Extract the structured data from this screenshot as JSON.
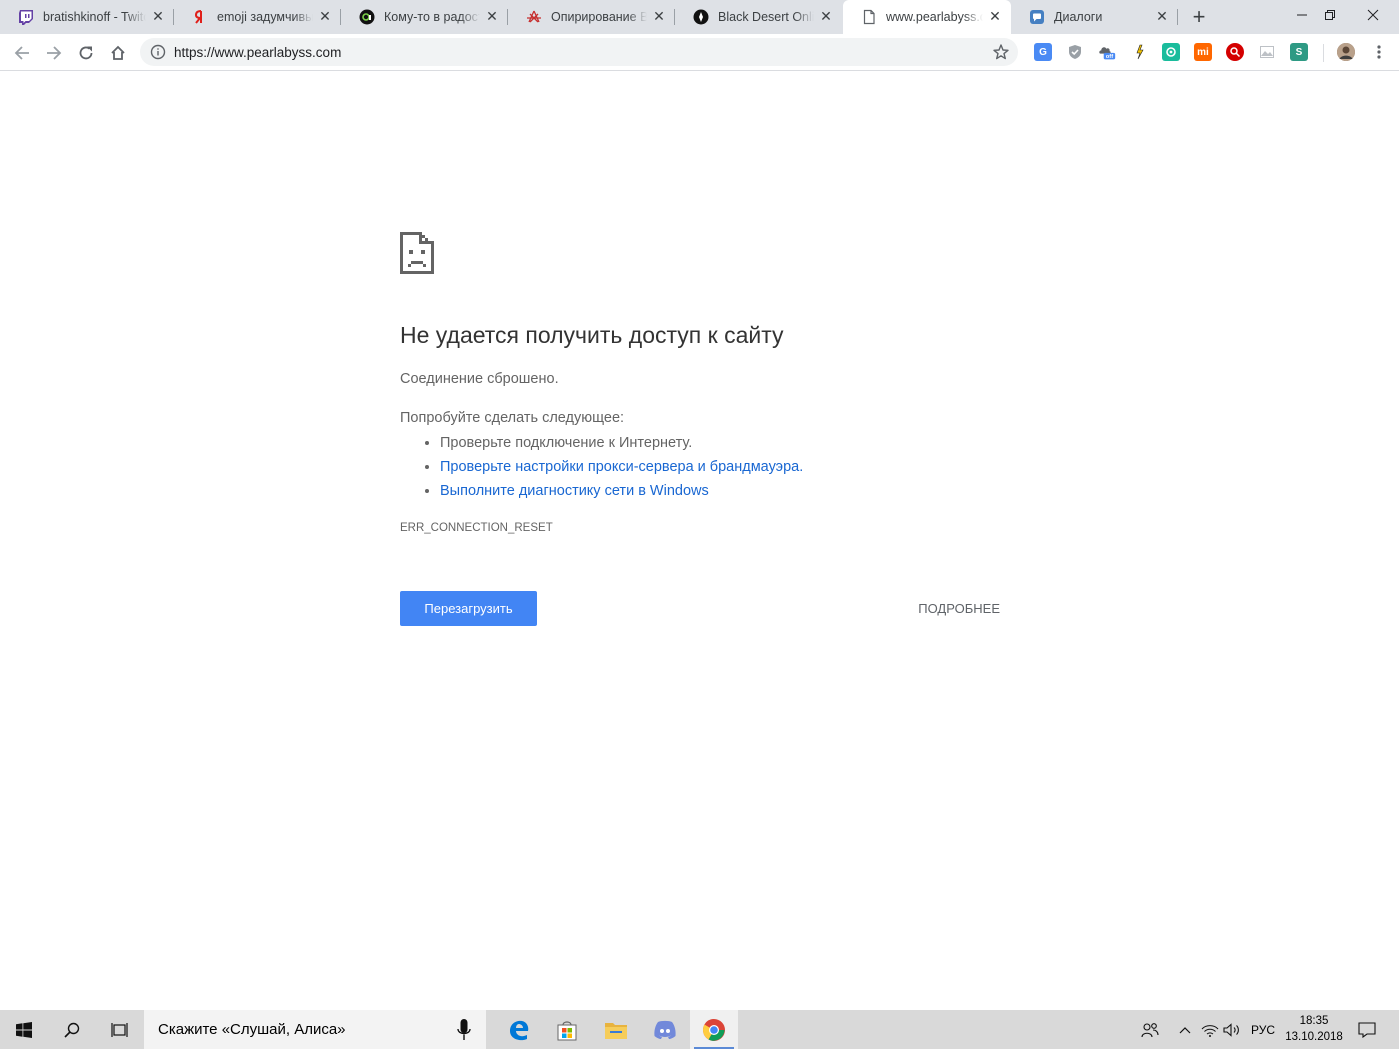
{
  "tabs": [
    {
      "title": "bratishkinoff - Twitch",
      "icon": "twitch-icon"
    },
    {
      "title": "emoji задумчивый",
      "icon": "yandex-icon"
    },
    {
      "title": "Кому-то в радость",
      "icon": "site-icon"
    },
    {
      "title": "Опирирование Black",
      "icon": "redspider-icon"
    },
    {
      "title": "Black Desert Online",
      "icon": "blackdesert-icon"
    },
    {
      "title": "www.pearlabyss.com",
      "icon": "page-icon",
      "active": true
    },
    {
      "title": "Диалоги",
      "icon": "chat-icon"
    }
  ],
  "window": {
    "minimize": "—",
    "maximize": "❐",
    "close": "✕"
  },
  "toolbar": {
    "url": "https://www.pearlabyss.com"
  },
  "error": {
    "heading": "Не удается получить доступ к сайту",
    "subheading": "Соединение сброшено.",
    "try_label": "Попробуйте сделать следующее:",
    "suggestions": [
      {
        "text": "Проверьте подключение к Интернету.",
        "link": false
      },
      {
        "text": "Проверьте настройки прокси-сервера и брандмауэра.",
        "link": true
      },
      {
        "text": "Выполните диагностику сети в Windows",
        "link": true
      }
    ],
    "code": "ERR_CONNECTION_RESET",
    "reload_label": "Перезагрузить",
    "details_label": "ПОДРОБНЕЕ"
  },
  "taskbar": {
    "search_placeholder": "Скажите «Слушай, Алиса»",
    "language": "РУС",
    "time": "18:35",
    "date": "13.10.2018"
  },
  "colors": {
    "accent": "#4285f4",
    "link": "#1967d2",
    "tabstrip": "#dee1e6",
    "taskbar": "#d9d9d9"
  }
}
